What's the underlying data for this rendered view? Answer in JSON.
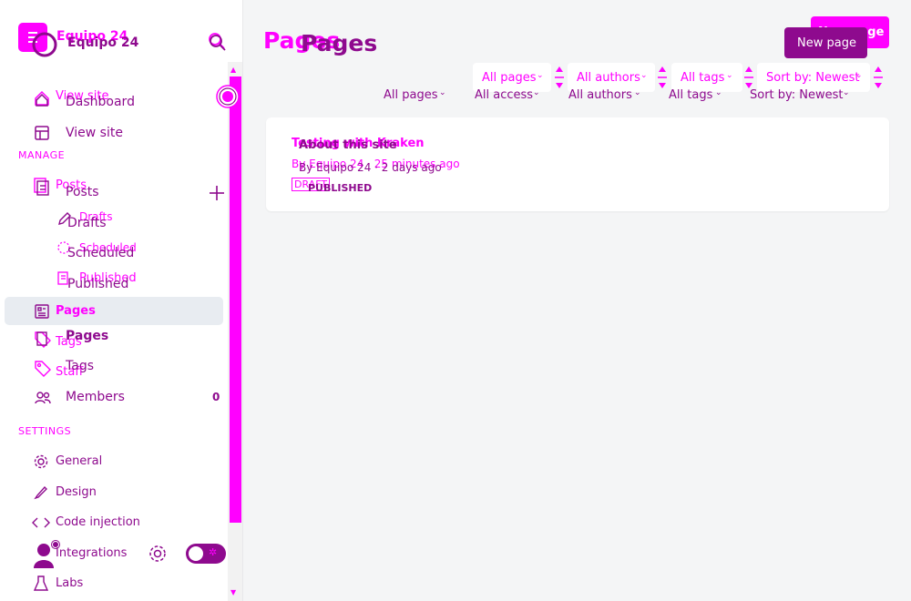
{
  "sidebar": {
    "site_title_a": "Equipo 24",
    "site_title_b": "Equipo 24",
    "ghost_view_site": "View site",
    "dashboard": "Dashboard",
    "view_site": "View site",
    "manage_heading": "MANAGE",
    "ghost_posts": "Posts",
    "posts": "Posts",
    "ghost_drafts": "Drafts",
    "drafts": "Drafts",
    "ghost_scheduled": "Scheduled",
    "scheduled": "Scheduled",
    "ghost_published": "Published",
    "published": "Published",
    "pages_active": "Pages",
    "ghost_tags": "Tags",
    "pages": "Pages",
    "ghost_staff": "Staff",
    "tags": "Tags",
    "members": "Members",
    "members_count": "0",
    "settings_heading": "SETTINGS",
    "general": "General",
    "design": "Design",
    "code_injection": "Code injection",
    "integrations": "Integrations",
    "labs": "Labs"
  },
  "header": {
    "title_ghost": "Pages",
    "title": "Pages",
    "new_page_ghost": "New page",
    "new_page": "New page"
  },
  "filters_top": {
    "type": "All pages",
    "authors": "All authors",
    "tags": "All tags",
    "sort": "Sort by: Newest"
  },
  "filters": {
    "type": "All pages",
    "access": "All access",
    "authors": "All authors",
    "tags": "All tags",
    "sort": "Sort by: Newest"
  },
  "page_item": {
    "title_ghost": "Testing with Kraken",
    "title": "About this site",
    "meta_ghost": "By Equipo 24 · 25 minutes ago",
    "meta": "By Equipo 24 · 2 days ago",
    "status_ghost": "DRAFT",
    "status": "PUBLISHED"
  },
  "colors": {
    "accent_magenta": "#ff00ff",
    "accent_purple": "#8e0a8e",
    "active_nav_bg": "#e8ecf1"
  }
}
